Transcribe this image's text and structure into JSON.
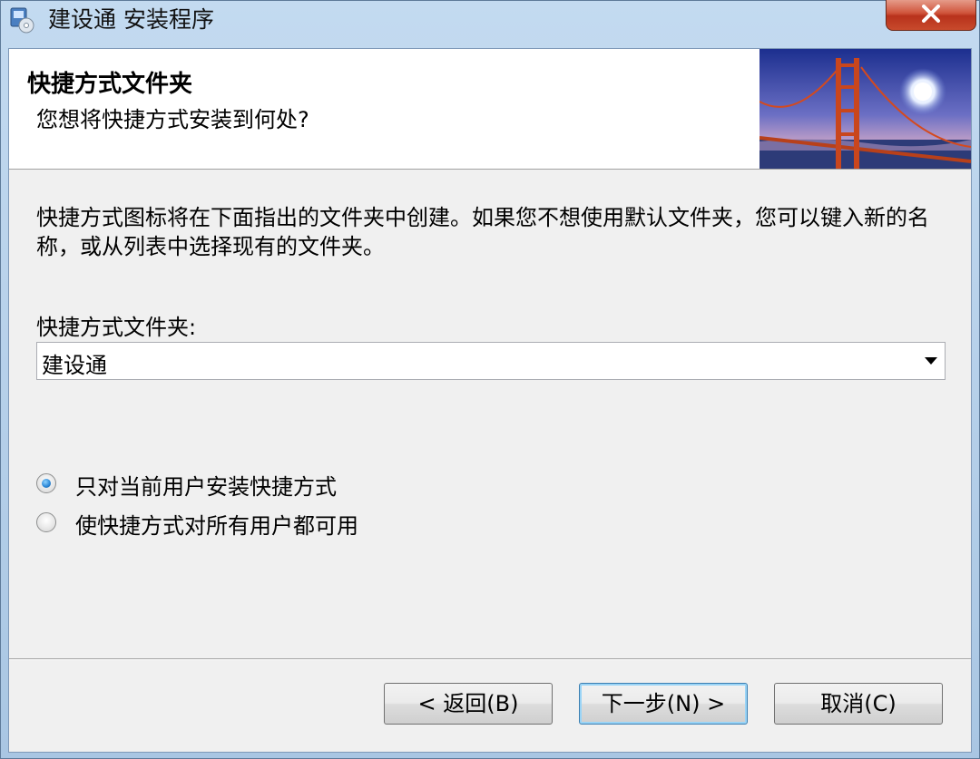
{
  "window": {
    "title": "建设通 安装程序",
    "icons": {
      "app": "installer-cd-icon",
      "close": "close-x-icon"
    }
  },
  "header": {
    "title": "快捷方式文件夹",
    "subtitle": "您想将快捷方式安装到何处?",
    "image": "golden-gate-bridge-image"
  },
  "body": {
    "description": "快捷方式图标将在下面指出的文件夹中创建。如果您不想使用默认文件夹，您可以键入新的名称，或从列表中选择现有的文件夹。",
    "folder_label": "快捷方式文件夹:",
    "folder_value": "建设通",
    "options": [
      {
        "label": "只对当前用户安装快捷方式",
        "checked": true
      },
      {
        "label": "使快捷方式对所有用户都可用",
        "checked": false
      }
    ]
  },
  "buttons": {
    "back": "< 返回(B)",
    "next": "下一步(N) >",
    "cancel": "取消(C)"
  },
  "colors": {
    "client_bg": "#f0f0f0",
    "header_bg": "#ffffff",
    "close_red": "#c84a2c",
    "default_button_border": "#3c7fb1"
  }
}
